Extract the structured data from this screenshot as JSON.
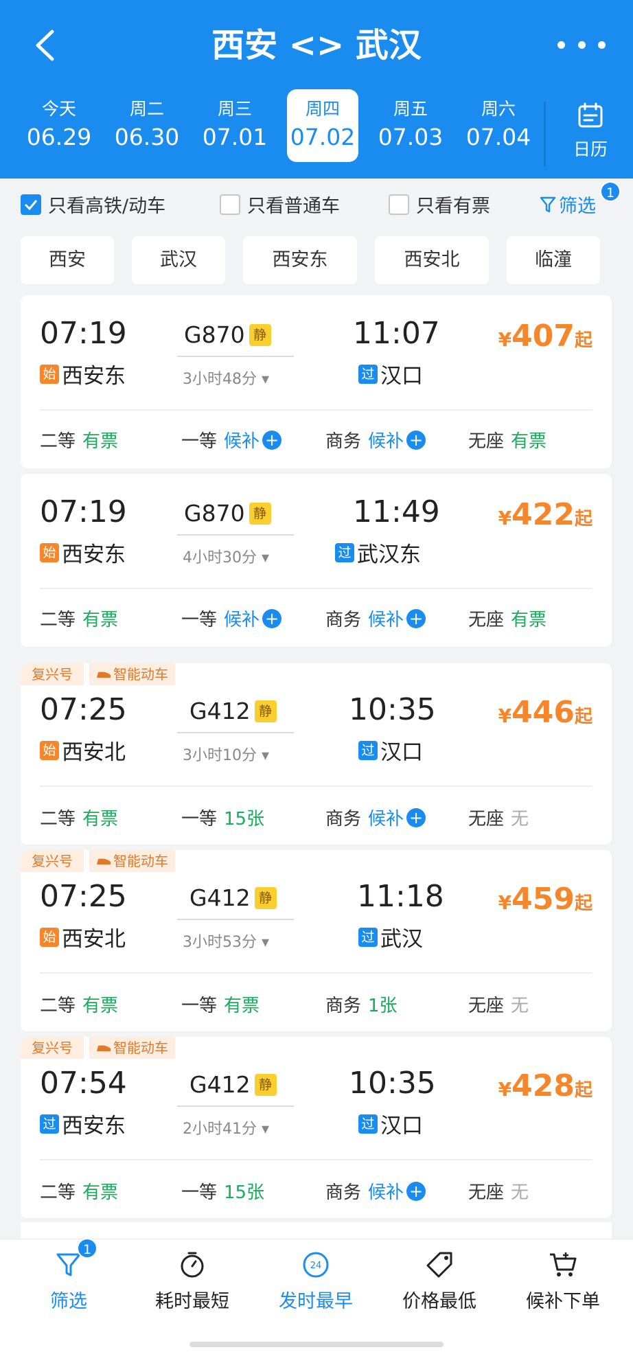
{
  "header": {
    "title": "西安 <> 武汉",
    "dates": [
      {
        "weekday": "今天",
        "date": "06.29",
        "active": false
      },
      {
        "weekday": "周二",
        "date": "06.30",
        "active": false
      },
      {
        "weekday": "周三",
        "date": "07.01",
        "active": false
      },
      {
        "weekday": "周四",
        "date": "07.02",
        "active": true
      },
      {
        "weekday": "周五",
        "date": "07.03",
        "active": false
      },
      {
        "weekday": "周六",
        "date": "07.04",
        "active": false
      }
    ],
    "calendar_label": "日历"
  },
  "filters": {
    "only_highspeed": "只看高铁/动车",
    "only_normal": "只看普通车",
    "only_available": "只看有票",
    "filter_label": "筛选",
    "filter_count": "1"
  },
  "stations": [
    "西安",
    "武汉",
    "西安东",
    "西安北",
    "临潼"
  ],
  "trains": [
    {
      "dep_time": "07:19",
      "dep_icon": "始",
      "dep_station": "西安东",
      "train_no": "G870",
      "quiet": "静",
      "duration": "3小时48分",
      "arr_time": "11:07",
      "arr_icon": "过",
      "arr_station": "汉口",
      "price_symbol": "¥",
      "price": "407",
      "price_suffix": "起",
      "seats": [
        {
          "name": "二等",
          "status": "有票"
        },
        {
          "name": "一等",
          "status": "候补"
        },
        {
          "name": "商务",
          "status": "候补"
        },
        {
          "name": "无座",
          "status": "有票"
        }
      ]
    },
    {
      "dep_time": "07:19",
      "dep_icon": "始",
      "dep_station": "西安东",
      "train_no": "G870",
      "quiet": "静",
      "duration": "4小时30分",
      "arr_time": "11:49",
      "arr_icon": "过",
      "arr_station": "武汉东",
      "price_symbol": "¥",
      "price": "422",
      "price_suffix": "起",
      "seats": [
        {
          "name": "二等",
          "status": "有票"
        },
        {
          "name": "一等",
          "status": "候补"
        },
        {
          "name": "商务",
          "status": "候补"
        },
        {
          "name": "无座",
          "status": "有票"
        }
      ]
    },
    {
      "tag1": "复兴号",
      "tag2": "智能动车",
      "dep_time": "07:25",
      "dep_icon": "始",
      "dep_station": "西安北",
      "train_no": "G412",
      "quiet": "静",
      "duration": "3小时10分",
      "arr_time": "10:35",
      "arr_icon": "过",
      "arr_station": "汉口",
      "price_symbol": "¥",
      "price": "446",
      "price_suffix": "起",
      "seats": [
        {
          "name": "二等",
          "status": "有票"
        },
        {
          "name": "一等",
          "status": "15张"
        },
        {
          "name": "商务",
          "status": "候补"
        },
        {
          "name": "无座",
          "status": "无"
        }
      ]
    },
    {
      "tag1": "复兴号",
      "tag2": "智能动车",
      "dep_time": "07:25",
      "dep_icon": "始",
      "dep_station": "西安北",
      "train_no": "G412",
      "quiet": "静",
      "duration": "3小时53分",
      "arr_time": "11:18",
      "arr_icon": "过",
      "arr_station": "武汉",
      "price_symbol": "¥",
      "price": "459",
      "price_suffix": "起",
      "seats": [
        {
          "name": "二等",
          "status": "有票"
        },
        {
          "name": "一等",
          "status": "有票"
        },
        {
          "name": "商务",
          "status": "1张"
        },
        {
          "name": "无座",
          "status": "无"
        }
      ]
    },
    {
      "tag1": "复兴号",
      "tag2": "智能动车",
      "dep_time": "07:54",
      "dep_icon": "过",
      "dep_station": "西安东",
      "train_no": "G412",
      "quiet": "静",
      "duration": "2小时41分",
      "arr_time": "10:35",
      "arr_icon": "过",
      "arr_station": "汉口",
      "price_symbol": "¥",
      "price": "428",
      "price_suffix": "起",
      "seats": [
        {
          "name": "二等",
          "status": "有票"
        },
        {
          "name": "一等",
          "status": "15张"
        },
        {
          "name": "商务",
          "status": "候补"
        },
        {
          "name": "无座",
          "status": "无"
        }
      ]
    }
  ],
  "bottom_nav": {
    "filter": "筛选",
    "filter_count": "1",
    "shortest": "耗时最短",
    "earliest": "发时最早",
    "earliest_icon_text": "24",
    "cheapest": "价格最低",
    "waitlist": "候补下单"
  },
  "colors": {
    "primary": "#1a8cf0",
    "price": "#f5862a",
    "available": "#1aab5a",
    "unavailable": "#aaaaaa"
  }
}
